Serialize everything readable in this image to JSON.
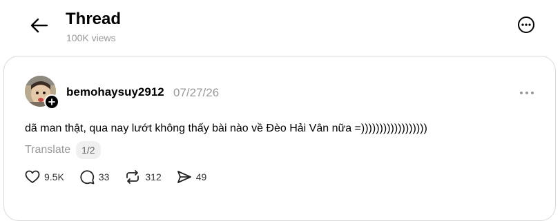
{
  "header": {
    "title": "Thread",
    "views": "100K views",
    "back_icon": "arrow-left-icon",
    "more_icon": "ellipsis-circle-icon"
  },
  "post": {
    "username": "bemohaysuy2912",
    "date": "07/27/26",
    "text": "dã man thật, qua nay lướt không thấy bài nào về Đèo Hải Vân nữa =))))))))))))))))))",
    "translate_label": "Translate",
    "page_indicator": "1/2",
    "actions": {
      "likes": "9.5K",
      "replies": "33",
      "reposts": "312",
      "shares": "49"
    }
  },
  "colors": {
    "text": "#000000",
    "muted": "#999999",
    "border": "#d9d9d9",
    "pill_bg": "#f0f0f0"
  }
}
